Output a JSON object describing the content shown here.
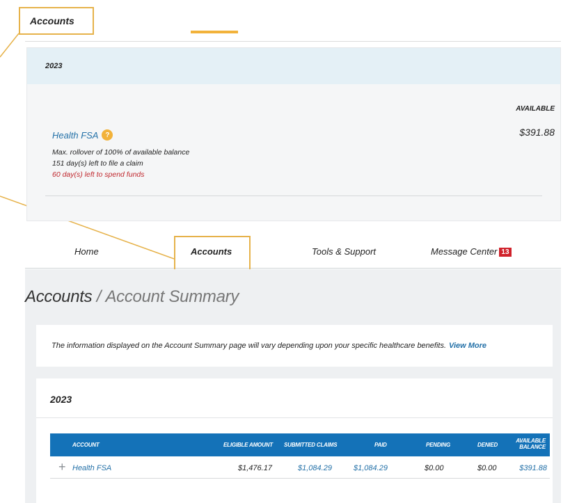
{
  "callout": {
    "top_label": "Accounts"
  },
  "summary_panel": {
    "year": "2023",
    "available_header": "AVAILABLE",
    "account_name": "Health FSA",
    "help_icon": "?",
    "available_value": "$391.88",
    "rollover_note": "Max. rollover of 100% of available balance",
    "claim_days": "151 day(s) left to file a claim",
    "spend_days": "60 day(s) left to spend funds"
  },
  "nav": {
    "items": [
      {
        "label": "Home"
      },
      {
        "label": "Accounts"
      },
      {
        "label": "Tools & Support"
      },
      {
        "label": "Message Center"
      }
    ],
    "message_count": "13",
    "active": "Accounts"
  },
  "page": {
    "title_section": "Accounts",
    "title_separator": "/",
    "title_page": "Account Summary",
    "info_text": "The information displayed on the Account Summary page will vary depending upon your specific healthcare benefits.",
    "info_link": "View More"
  },
  "accounts_table": {
    "year": "2023",
    "columns": [
      "ACCOUNT",
      "ELIGIBLE AMOUNT",
      "SUBMITTED CLAIMS",
      "PAID",
      "PENDING",
      "DENIED",
      "AVAILABLE",
      "BALANCE"
    ],
    "rows": [
      {
        "expand": "+",
        "account": "Health FSA",
        "eligible_amount": "$1,476.17",
        "submitted_claims": "$1,084.29",
        "paid": "$1,084.29",
        "pending": "$0.00",
        "denied": "$0.00",
        "available_balance": "$391.88"
      }
    ]
  },
  "colors": {
    "accent": "#f2b23a",
    "link": "#2471a8",
    "table_header": "#1472b8",
    "badge": "#d0222b",
    "warning_text": "#c0272d"
  }
}
